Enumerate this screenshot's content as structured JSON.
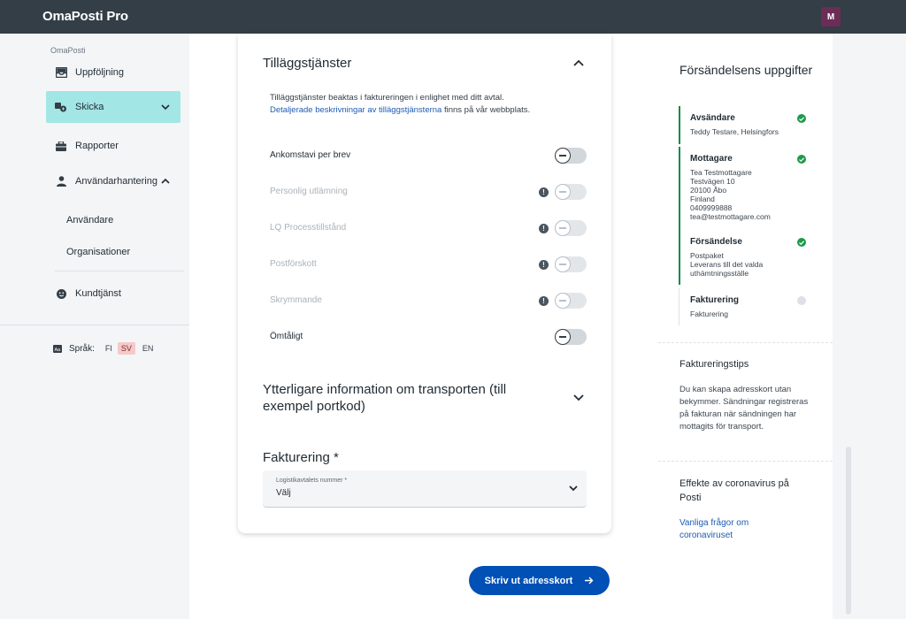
{
  "app": {
    "brand": "OmaPosti Pro",
    "avatar_initial": "M"
  },
  "sidebar": {
    "section_label": "OmaPosti",
    "items": [
      {
        "label": "Uppföljning",
        "icon": "inbox-icon"
      },
      {
        "label": "Skicka",
        "icon": "send-package-icon",
        "active": true
      },
      {
        "label": "Rapporter",
        "icon": "briefcase-icon"
      },
      {
        "label": "Användarhantering",
        "icon": "person-icon"
      }
    ],
    "subitems": [
      {
        "label": "Användare"
      },
      {
        "label": "Organisationer"
      }
    ],
    "support": {
      "label": "Kundtjänst",
      "icon": "smiley-icon"
    },
    "language": {
      "label": "Språk:",
      "options": [
        "FI",
        "SV",
        "EN"
      ],
      "selected": "SV"
    }
  },
  "addons": {
    "title": "Tilläggstjänster",
    "info_text": "Tilläggstjänster beaktas i faktureringen i enlighet med ditt avtal.",
    "info_link": "Detaljerade beskrivningar av tilläggstjänsterna",
    "info_suffix": " finns på vår webbplats.",
    "services": [
      {
        "label": "Ankomstavi per brev",
        "enabled": true,
        "warning": false,
        "on": false
      },
      {
        "label": "Personlig utlämning",
        "enabled": false,
        "warning": true,
        "on": false
      },
      {
        "label": "LQ Processtillstånd",
        "enabled": false,
        "warning": true,
        "on": false
      },
      {
        "label": "Postförskott",
        "enabled": false,
        "warning": true,
        "on": false
      },
      {
        "label": "Skrymmande",
        "enabled": false,
        "warning": true,
        "on": false
      },
      {
        "label": "Ömtåligt",
        "enabled": true,
        "warning": false,
        "on": false
      }
    ]
  },
  "extra_info": {
    "title": "Ytterligare information om transporten (till exempel portkod)"
  },
  "billing": {
    "title": "Fakturering *",
    "select_label": "Logistikavtalets nummer *",
    "select_value": "Välj"
  },
  "print_button": {
    "label": "Skriv ut adresskort"
  },
  "summary": {
    "title": "Försändelsens uppgifter",
    "steps": [
      {
        "title": "Avsändare",
        "lines": [
          "Teddy Testare, Helsingfors"
        ],
        "done": true
      },
      {
        "title": "Mottagare",
        "lines": [
          "Tea Testmottagare",
          "Testvägen 10",
          "20100 Åbo",
          "Finland",
          "0409999888",
          "tea@testmottagare.com"
        ],
        "done": true
      },
      {
        "title": "Försändelse",
        "lines": [
          "Postpaket",
          "Leverans till det valda",
          "uthämtningsställe"
        ],
        "done": true
      },
      {
        "title": "Fakturering",
        "lines": [
          "Fakturering"
        ],
        "done": false
      }
    ],
    "tips": {
      "title": "Faktureringstips",
      "text": "Du kan skapa adresskort utan bekymmer. Sändningar registreras på fakturan när sändningen har mottagits för transport."
    },
    "corona": {
      "title": "Effekte av coronavirus på Posti",
      "link": "Vanliga frågor om coronaviruset"
    }
  },
  "colors": {
    "topbar": "#333e47",
    "active_nav": "#a3e6e6",
    "primary_button": "#0050b5",
    "check_green": "#1f9a4a",
    "link": "#1e5cb3"
  }
}
